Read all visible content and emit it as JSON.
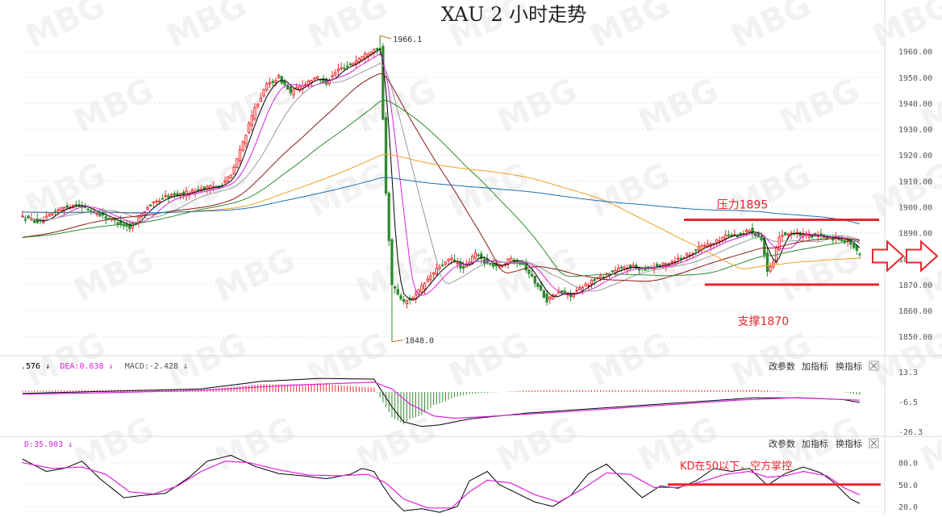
{
  "chart_data": [
    {
      "type": "candlestick",
      "title": "XAU 2 小时走势",
      "y_ticks": [
        1960,
        1950,
        1940,
        1930,
        1920,
        1910,
        1900,
        1890,
        1880,
        1870,
        1860,
        1850
      ],
      "y_tick_labels": [
        "1960.00",
        "1950.00",
        "1940.00",
        "1930.00",
        "1920.00",
        "1910.00",
        "1900.00",
        "1890.00",
        "1880.00",
        "1870.00",
        "1860.00",
        "1850.00"
      ],
      "ylim": [
        1846,
        1968
      ],
      "high_marker": {
        "label": "1966.1",
        "value": 1966.1
      },
      "low_marker": {
        "label": "1848.0",
        "value": 1848.0
      },
      "close_anchors": [
        [
          0,
          1896
        ],
        [
          6,
          1894
        ],
        [
          12,
          1899
        ],
        [
          18,
          1901
        ],
        [
          24,
          1898
        ],
        [
          30,
          1895
        ],
        [
          36,
          1892
        ],
        [
          42,
          1900
        ],
        [
          48,
          1904
        ],
        [
          54,
          1905
        ],
        [
          60,
          1907
        ],
        [
          66,
          1908
        ],
        [
          70,
          1912
        ],
        [
          74,
          1925
        ],
        [
          78,
          1938
        ],
        [
          82,
          1947
        ],
        [
          86,
          1950
        ],
        [
          90,
          1944
        ],
        [
          94,
          1947
        ],
        [
          98,
          1950
        ],
        [
          102,
          1948
        ],
        [
          106,
          1953
        ],
        [
          110,
          1955
        ],
        [
          114,
          1958
        ],
        [
          118,
          1961
        ],
        [
          120,
          1962
        ],
        [
          122,
          1905
        ],
        [
          124,
          1870
        ],
        [
          128,
          1863
        ],
        [
          132,
          1866
        ],
        [
          136,
          1872
        ],
        [
          140,
          1877
        ],
        [
          144,
          1880
        ],
        [
          148,
          1876
        ],
        [
          152,
          1882
        ],
        [
          156,
          1878
        ],
        [
          160,
          1877
        ],
        [
          164,
          1880
        ],
        [
          168,
          1878
        ],
        [
          172,
          1871
        ],
        [
          176,
          1864
        ],
        [
          180,
          1867
        ],
        [
          184,
          1866
        ],
        [
          188,
          1869
        ],
        [
          192,
          1872
        ],
        [
          196,
          1874
        ],
        [
          200,
          1876
        ],
        [
          204,
          1877
        ],
        [
          208,
          1876
        ],
        [
          212,
          1877
        ],
        [
          216,
          1878
        ],
        [
          220,
          1880
        ],
        [
          224,
          1882
        ],
        [
          228,
          1885
        ],
        [
          232,
          1886
        ],
        [
          236,
          1889
        ],
        [
          240,
          1889
        ],
        [
          244,
          1891
        ],
        [
          248,
          1888
        ],
        [
          250,
          1875
        ],
        [
          252,
          1878
        ],
        [
          254,
          1889
        ],
        [
          258,
          1890
        ],
        [
          262,
          1889
        ],
        [
          266,
          1889
        ],
        [
          270,
          1888
        ],
        [
          274,
          1888
        ],
        [
          278,
          1886
        ],
        [
          281,
          1881
        ]
      ],
      "moving_averages": [
        {
          "name": "ma-short",
          "period": 5,
          "color": "#000000"
        },
        {
          "name": "ma-10",
          "period": 10,
          "color": "#dd22dd"
        },
        {
          "name": "ma-20",
          "period": 20,
          "color": "#9a9a9a"
        },
        {
          "name": "ma-40",
          "period": 40,
          "color": "#8b1a1a"
        },
        {
          "name": "ma-60",
          "period": 60,
          "color": "#2e8b2e"
        },
        {
          "name": "ma-120",
          "period": 120,
          "color": "#f0a020"
        },
        {
          "name": "ma-200",
          "period": 200,
          "color": "#1e6eb0"
        }
      ],
      "annotations": [
        {
          "name": "resistance",
          "label": "压力1895",
          "value": 1895,
          "color": "#e8262c"
        },
        {
          "name": "support",
          "label": "支撑1870",
          "value": 1870,
          "color": "#e8262c"
        }
      ],
      "colors": {
        "up": "#ef2b2b",
        "down": "#2e8b2e",
        "arrow": "#e8262c"
      },
      "watermark": "MBG"
    },
    {
      "type": "macd",
      "legend": [
        {
          "label": ".576 ↓",
          "color": "#000000"
        },
        {
          "label": "DEA:0.638 ↓",
          "color": "#dd22dd"
        },
        {
          "label": "MACD:-2.428 ↓",
          "color": "#555555"
        }
      ],
      "y_tick_labels": [
        "13.3",
        "-6.5",
        "-26.3"
      ],
      "ylim": [
        -28,
        15
      ],
      "dif_anchors": [
        [
          0,
          -1.0
        ],
        [
          30,
          0.5
        ],
        [
          60,
          2.0
        ],
        [
          80,
          7.0
        ],
        [
          100,
          9.0
        ],
        [
          118,
          8.5
        ],
        [
          124,
          -10.0
        ],
        [
          128,
          -20.0
        ],
        [
          134,
          -23.0
        ],
        [
          140,
          -22.0
        ],
        [
          150,
          -18.0
        ],
        [
          170,
          -14.0
        ],
        [
          200,
          -10.0
        ],
        [
          230,
          -6.0
        ],
        [
          245,
          -4.0
        ],
        [
          260,
          -4.0
        ],
        [
          275,
          -5.0
        ],
        [
          281,
          -7.0
        ]
      ],
      "dea_anchors": [
        [
          0,
          -1.5
        ],
        [
          30,
          -0.5
        ],
        [
          60,
          1.0
        ],
        [
          90,
          4.5
        ],
        [
          118,
          6.5
        ],
        [
          124,
          2.0
        ],
        [
          130,
          -8.0
        ],
        [
          138,
          -16.0
        ],
        [
          145,
          -17.5
        ],
        [
          155,
          -16.5
        ],
        [
          180,
          -13.5
        ],
        [
          210,
          -9.5
        ],
        [
          240,
          -5.5
        ],
        [
          260,
          -3.8
        ],
        [
          281,
          -5.5
        ]
      ],
      "toolbar": [
        "改参数",
        "加指标",
        "换指标"
      ]
    },
    {
      "type": "kdj",
      "legend": [
        {
          "label": "D:35.903 ↓",
          "color": "#dd22dd"
        }
      ],
      "y_tick_labels": [
        "80.0",
        "50.0",
        "20.0"
      ],
      "ylim": [
        10,
        95
      ],
      "k_anchors": [
        [
          0,
          85
        ],
        [
          8,
          68
        ],
        [
          14,
          72
        ],
        [
          20,
          82
        ],
        [
          26,
          58
        ],
        [
          34,
          32
        ],
        [
          40,
          35
        ],
        [
          48,
          38
        ],
        [
          56,
          60
        ],
        [
          62,
          82
        ],
        [
          70,
          90
        ],
        [
          78,
          75
        ],
        [
          86,
          65
        ],
        [
          94,
          62
        ],
        [
          102,
          58
        ],
        [
          110,
          64
        ],
        [
          114,
          72
        ],
        [
          118,
          68
        ],
        [
          121,
          48
        ],
        [
          124,
          30
        ],
        [
          128,
          14
        ],
        [
          134,
          17
        ],
        [
          140,
          12
        ],
        [
          146,
          20
        ],
        [
          150,
          55
        ],
        [
          156,
          68
        ],
        [
          160,
          50
        ],
        [
          166,
          38
        ],
        [
          172,
          26
        ],
        [
          178,
          20
        ],
        [
          184,
          35
        ],
        [
          190,
          65
        ],
        [
          196,
          78
        ],
        [
          202,
          55
        ],
        [
          208,
          32
        ],
        [
          214,
          48
        ],
        [
          220,
          45
        ],
        [
          226,
          55
        ],
        [
          232,
          72
        ],
        [
          238,
          68
        ],
        [
          244,
          72
        ],
        [
          250,
          49
        ],
        [
          256,
          65
        ],
        [
          262,
          74
        ],
        [
          268,
          66
        ],
        [
          272,
          54
        ],
        [
          278,
          30
        ],
        [
          281,
          24
        ]
      ],
      "d_anchors": [
        [
          0,
          80
        ],
        [
          10,
          72
        ],
        [
          20,
          74
        ],
        [
          28,
          64
        ],
        [
          36,
          40
        ],
        [
          44,
          37
        ],
        [
          52,
          48
        ],
        [
          60,
          68
        ],
        [
          68,
          82
        ],
        [
          76,
          80
        ],
        [
          86,
          70
        ],
        [
          96,
          63
        ],
        [
          106,
          62
        ],
        [
          116,
          64
        ],
        [
          122,
          52
        ],
        [
          128,
          30
        ],
        [
          136,
          18
        ],
        [
          144,
          18
        ],
        [
          150,
          40
        ],
        [
          156,
          56
        ],
        [
          164,
          52
        ],
        [
          172,
          36
        ],
        [
          180,
          26
        ],
        [
          188,
          44
        ],
        [
          196,
          66
        ],
        [
          204,
          64
        ],
        [
          212,
          46
        ],
        [
          220,
          46
        ],
        [
          228,
          54
        ],
        [
          236,
          64
        ],
        [
          244,
          68
        ],
        [
          250,
          60
        ],
        [
          256,
          62
        ],
        [
          262,
          68
        ],
        [
          270,
          62
        ],
        [
          276,
          45
        ],
        [
          281,
          36
        ]
      ],
      "toolbar": [
        "改参数",
        "加指标",
        "换指标"
      ],
      "annotations": [
        {
          "name": "kd-level-50",
          "label": "KD在50以下，空方掌控",
          "value": 50,
          "color": "#e8262c"
        }
      ]
    }
  ]
}
